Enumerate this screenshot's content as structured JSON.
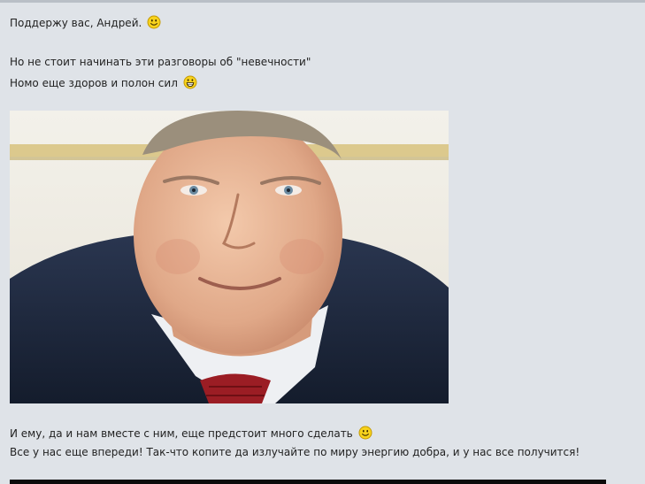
{
  "post": {
    "line1": "Поддержу вас, Андрей.",
    "line2": "Но не стоит начинать эти разговоры об \"невечности\"",
    "line3": "Номо еще здоров и полон сил",
    "line4": "И ему, да и нам вместе с ним, еще предстоит много сделать",
    "line5": "Все у нас еще впереди! Так-что копите да излучайте по миру энергию добра, и у нас все получится!"
  },
  "emoticons": [
    "smile-emoticon",
    "grin-emoticon",
    "smile-emoticon"
  ],
  "colors": {
    "background": "#dfe3e8",
    "text": "#222222",
    "smiley_yellow": "#f7d21c"
  }
}
